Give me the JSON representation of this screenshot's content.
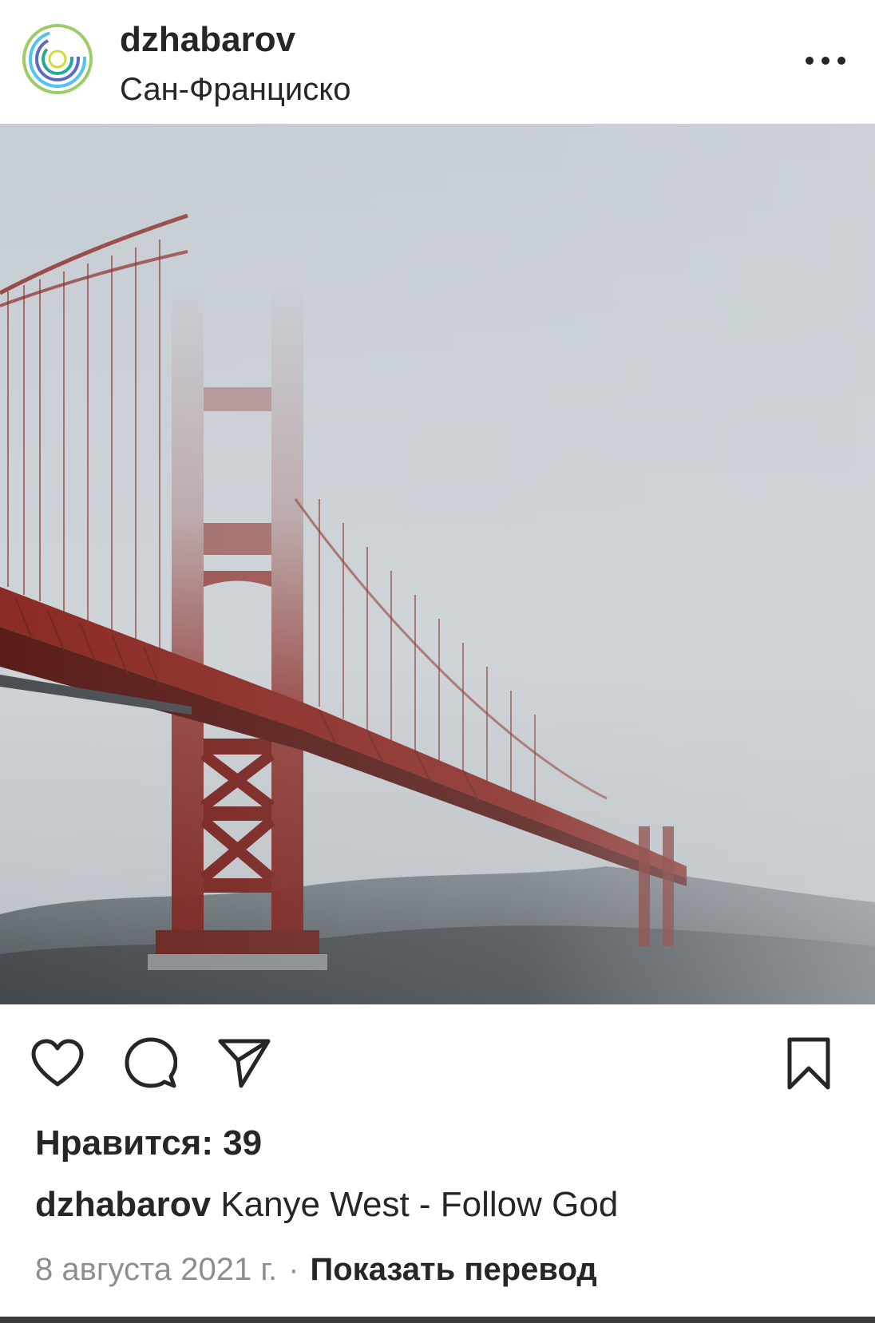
{
  "post": {
    "username": "dzhabarov",
    "location": "Сан-Франциско",
    "likes_label": "Нравится: 39",
    "caption_author": "dzhabarov",
    "caption_text": " Kanye West - Follow God",
    "date": "8 августа 2021 г.",
    "separator": "·",
    "translate_label": "Показать перевод"
  },
  "icons": {
    "avatar": "ring-logo-avatar",
    "more": "more-options-icon",
    "like": "heart-icon",
    "comment": "comment-icon",
    "share": "send-icon",
    "save": "bookmark-icon"
  },
  "colors": {
    "text": "#262626",
    "muted": "#8e8e8e",
    "bridge_red": "#8b2b25",
    "fog": "#c9ced3"
  }
}
